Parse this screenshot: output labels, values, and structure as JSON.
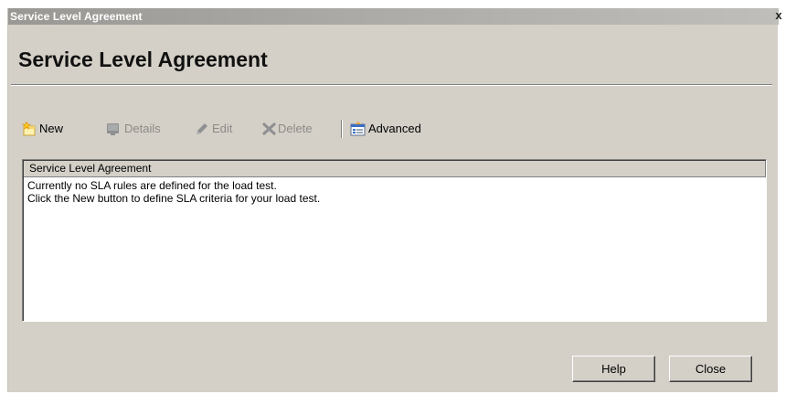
{
  "window": {
    "title": "Service Level Agreement",
    "close_glyph": "x"
  },
  "heading": "Service Level Agreement",
  "toolbar": {
    "items": [
      {
        "label": "New",
        "icon": "new-sparkle-icon",
        "enabled": true
      },
      {
        "label": "Details",
        "icon": "details-monitor-icon",
        "enabled": false
      },
      {
        "label": "Edit",
        "icon": "pencil-icon",
        "enabled": false
      },
      {
        "label": "Delete",
        "icon": "delete-x-icon",
        "enabled": false
      },
      {
        "label": "Advanced",
        "icon": "advanced-properties-icon",
        "enabled": true
      }
    ]
  },
  "list": {
    "column_header": "Service Level Agreement",
    "messages": [
      "Currently no SLA rules are defined for the load test.",
      "Click the New button to define SLA criteria for your load test."
    ]
  },
  "buttons": {
    "help": "Help",
    "close": "Close"
  },
  "colors": {
    "dialog_bg": "#d4d0c8",
    "titlebar": "#aeaca8",
    "disabled_text": "#8c8a86"
  }
}
